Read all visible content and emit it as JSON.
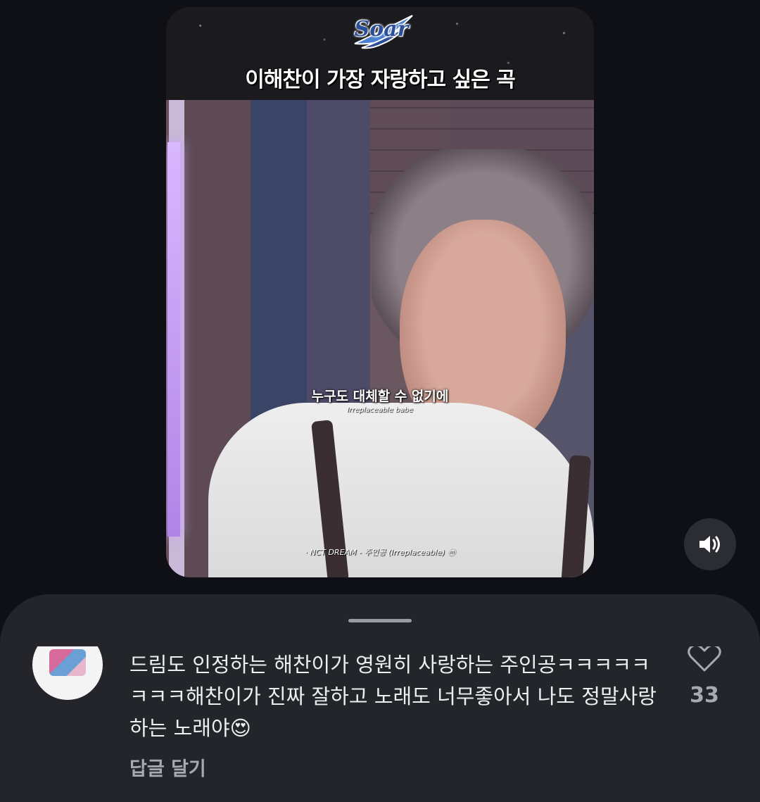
{
  "video": {
    "brand_logo": "Soar",
    "banner_title": "이해찬이 가장 자랑하고 싶은 곡",
    "subtitle_korean": "누구도 대체할 수 없기에",
    "subtitle_english": "Irreplaceable babe",
    "credit": "· NCT DREAM - 주인공 (Irreplaceable) ⓜ",
    "sound_icon": "speaker-volume-icon"
  },
  "comment": {
    "text": "드림도 인정하는 해찬이가 영원히 사랑하는 주인공ㅋㅋㅋㅋㅋㅋㅋㅋ해찬이가 진짜 잘하고 노래도 너무좋아서 나도 정말사랑하는 노래야😍",
    "reply_label": "답글 달기",
    "like_count": "33",
    "like_icon": "heart-outline-icon"
  },
  "colors": {
    "background": "#0e1016",
    "sheet": "#23252b",
    "logo_blue": "#2c4f9a",
    "muted_text": "#a8aab0"
  }
}
